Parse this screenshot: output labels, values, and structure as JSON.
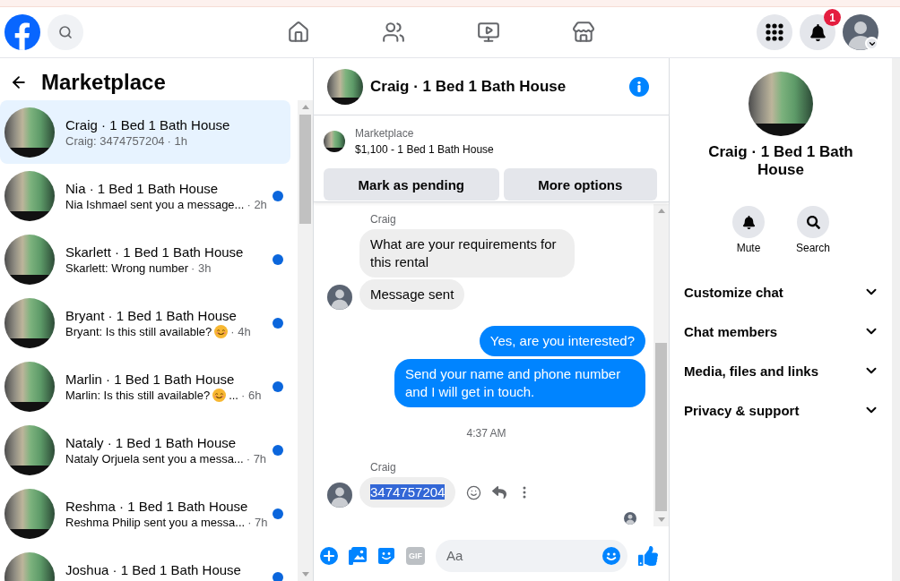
{
  "top_nav": {
    "notifications_count": "1"
  },
  "sidebar": {
    "title": "Marketplace",
    "conversations": [
      {
        "name": "Craig · 1 Bed 1 Bath House",
        "message": "Craig: 3474757204",
        "emoji": false,
        "time": "· 1h",
        "unread": false,
        "selected": true
      },
      {
        "name": "Nia · 1 Bed 1 Bath House",
        "message": "Nia Ishmael sent you a message...",
        "emoji": false,
        "time": "· 2h",
        "unread": true,
        "selected": false
      },
      {
        "name": "Skarlett · 1 Bed 1 Bath House",
        "message": "Skarlett: Wrong number",
        "emoji": false,
        "time": "· 3h",
        "unread": true,
        "selected": false
      },
      {
        "name": "Bryant · 1 Bed 1 Bath House",
        "message": "Bryant: Is this still available?",
        "emoji": true,
        "time": "· 4h",
        "unread": true,
        "selected": false
      },
      {
        "name": "Marlin · 1 Bed 1 Bath House",
        "message": "Marlin: Is this still available?",
        "emoji": true,
        "tail": "...",
        "time": "· 6h",
        "unread": true,
        "selected": false
      },
      {
        "name": "Nataly · 1 Bed 1 Bath House",
        "message": "Nataly Orjuela sent you a messa...",
        "emoji": false,
        "time": "· 7h",
        "unread": true,
        "selected": false
      },
      {
        "name": "Reshma · 1 Bed 1 Bath House",
        "message": "Reshma Philip sent you a messa...",
        "emoji": false,
        "time": "· 7h",
        "unread": true,
        "selected": false
      },
      {
        "name": "Joshua · 1 Bed 1 Bath House",
        "unread": true,
        "selected": false
      }
    ]
  },
  "chat": {
    "title": "Craig · 1 Bed 1 Bath House",
    "listing": {
      "label": "Marketplace",
      "summary": "$1,100 - 1 Bed 1 Bath House",
      "actions": [
        "Mark as pending",
        "More options"
      ]
    },
    "messages": [
      {
        "kind": "sender",
        "text": "Craig"
      },
      {
        "kind": "incoming",
        "text": "What are your requirements for this rental",
        "avatar": false,
        "highlighted": false,
        "actions": false
      },
      {
        "kind": "incoming",
        "text": "Message sent",
        "avatar": true,
        "highlighted": false,
        "actions": false
      },
      {
        "kind": "outgoing",
        "text": "Yes, are you interested?"
      },
      {
        "kind": "outgoing",
        "text": "Send your name and phone number and I will get in touch."
      },
      {
        "kind": "timestamp",
        "text": "4:37 AM"
      },
      {
        "kind": "sender",
        "text": "Craig"
      },
      {
        "kind": "incoming",
        "text": "3474757204",
        "avatar": true,
        "highlighted": true,
        "actions": true
      },
      {
        "kind": "read_receipt"
      }
    ],
    "composer": {
      "gif_label": "GIF",
      "placeholder": "Aa"
    }
  },
  "details": {
    "title": "Craig · 1 Bed 1 Bath House",
    "actions": [
      {
        "kind": "mute",
        "label": "Mute"
      },
      {
        "kind": "search",
        "label": "Search"
      }
    ],
    "sections": [
      {
        "label": "Customize chat",
        "expanded": false
      },
      {
        "label": "Chat members",
        "expanded": false
      },
      {
        "label": "Media, files and links",
        "expanded": false
      },
      {
        "label": "Privacy & support",
        "expanded": false
      }
    ]
  }
}
